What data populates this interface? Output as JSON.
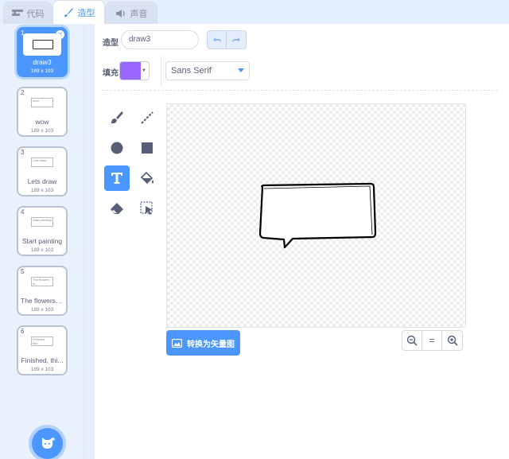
{
  "tabs": [
    {
      "label": "代码",
      "icon": "code-icon",
      "active": false
    },
    {
      "label": "造型",
      "icon": "brush-icon",
      "active": true
    },
    {
      "label": "声音",
      "icon": "speaker-icon",
      "active": false
    }
  ],
  "costumes": [
    {
      "number": "1",
      "name": "draw3",
      "size": "189 x 103",
      "selected": true,
      "thumb_text": ""
    },
    {
      "number": "2",
      "name": "wow",
      "size": "189 x 103",
      "selected": false,
      "thumb_text": "wow"
    },
    {
      "number": "3",
      "name": "Lets draw",
      "size": "189 x 103",
      "selected": false,
      "thumb_text": "Lets draw"
    },
    {
      "number": "4",
      "name": "Start painting",
      "size": "189 x 103",
      "selected": false,
      "thumb_text": "Start painting"
    },
    {
      "number": "5",
      "name": "The flowers i...",
      "size": "189 x 103",
      "selected": false,
      "thumb_text": "The flowers is..."
    },
    {
      "number": "6",
      "name": "Finished, thi...",
      "size": "189 x 103",
      "selected": false,
      "thumb_text": "Finished, this..."
    }
  ],
  "editor": {
    "costume_label": "造型",
    "costume_name": "draw3",
    "fill_label": "填充",
    "fill_color": "#9966ff",
    "font": "Sans Serif",
    "convert_button": "转换为矢量图",
    "zoom_reset_label": "="
  },
  "tools": [
    {
      "name": "brush-tool",
      "icon": "brush-icon",
      "active": false
    },
    {
      "name": "line-tool",
      "icon": "line-icon",
      "active": false
    },
    {
      "name": "circle-tool",
      "icon": "circle-icon",
      "active": false
    },
    {
      "name": "rectangle-tool",
      "icon": "rectangle-icon",
      "active": false
    },
    {
      "name": "text-tool",
      "icon": "text-icon",
      "active": true
    },
    {
      "name": "fill-tool",
      "icon": "paint-bucket-icon",
      "active": false
    },
    {
      "name": "eraser-tool",
      "icon": "eraser-icon",
      "active": false
    },
    {
      "name": "select-tool",
      "icon": "select-icon",
      "active": false
    }
  ],
  "colors": {
    "accent": "#4c97ff",
    "fill": "#9966ff",
    "text": "#575e75"
  }
}
